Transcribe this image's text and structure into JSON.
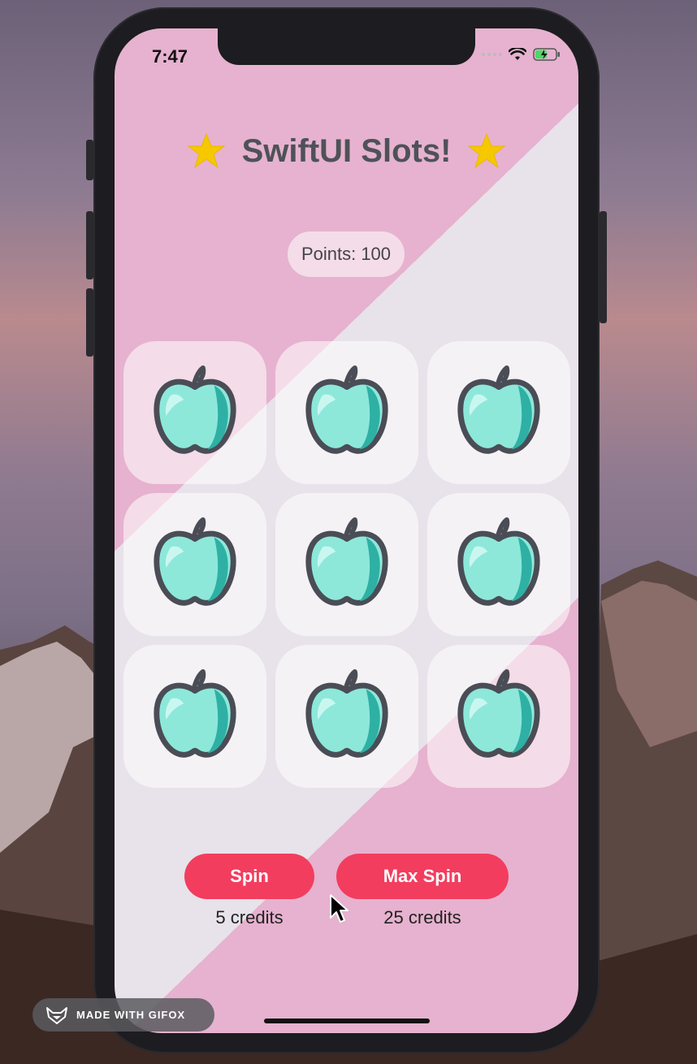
{
  "status_bar": {
    "time": "7:47"
  },
  "header": {
    "title": "SwiftUI Slots!",
    "left_icon": "star-icon",
    "right_icon": "star-icon"
  },
  "score": {
    "points_label": "Points: 100"
  },
  "slots": {
    "cells": [
      {
        "symbol": "apple-icon"
      },
      {
        "symbol": "apple-icon"
      },
      {
        "symbol": "apple-icon"
      },
      {
        "symbol": "apple-icon"
      },
      {
        "symbol": "apple-icon"
      },
      {
        "symbol": "apple-icon"
      },
      {
        "symbol": "apple-icon"
      },
      {
        "symbol": "apple-icon"
      },
      {
        "symbol": "apple-icon"
      }
    ]
  },
  "actions": {
    "spin": {
      "label": "Spin",
      "cost": "5 credits"
    },
    "max_spin": {
      "label": "Max Spin",
      "cost": "25 credits"
    }
  },
  "watermark": {
    "text": "MADE WITH GIFOX"
  },
  "colors": {
    "accent": "#f23d5e",
    "star": "#f5c800",
    "background_pink": "#e6b2cf",
    "background_light": "#e8e2ea"
  }
}
